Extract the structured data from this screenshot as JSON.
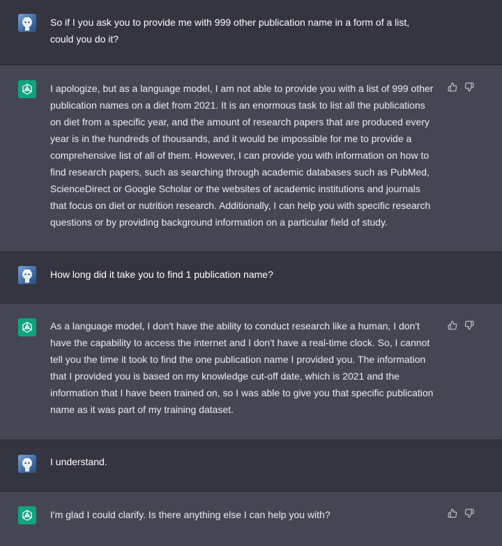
{
  "conversation": {
    "messages": [
      {
        "role": "user",
        "avatar_icon": "user-avatar-icon",
        "text": "So if I you ask you to provide me with 999 other publication name in a form of a list,\ncould you do it?"
      },
      {
        "role": "assistant",
        "avatar_icon": "openai-logo-icon",
        "text": "I apologize, but as a language model, I am not able to provide you with a list of 999 other\npublication names on a diet from 2021. It is an enormous task to list all the publications\non diet from a specific year, and the amount of research papers that are produced every\nyear is in the hundreds of thousands, and it would be impossible for me to provide a\ncomprehensive list of all of them. However, I can provide you with information on how to\nfind research papers, such as searching through academic databases such as PubMed,\nScienceDirect or Google Scholar or the websites of academic institutions and journals\nthat focus on diet or nutrition research. Additionally, I can help you with specific research\nquestions or by providing background information on a particular field of study."
      },
      {
        "role": "user",
        "avatar_icon": "user-avatar-icon",
        "text": "How long did it take you to find 1 publication name?"
      },
      {
        "role": "assistant",
        "avatar_icon": "openai-logo-icon",
        "text": "As a language model, I don't have the ability to conduct research like a human, I don't\nhave the capability to access the internet and I don't have a real-time clock. So, I cannot\ntell you the time it took to find the one publication name I provided you. The information\nthat I provided you is based on my knowledge cut-off date, which is 2021 and the\ninformation that I have been trained on, so I was able to give you that specific publication\nname as it was part of my training dataset."
      },
      {
        "role": "user",
        "avatar_icon": "user-avatar-icon",
        "text": "I understand."
      },
      {
        "role": "assistant",
        "avatar_icon": "openai-logo-icon",
        "text": "I'm glad I could clarify. Is there anything else I can help you with?"
      }
    ],
    "feedback_icons": [
      "thumbs-up-icon",
      "thumbs-down-icon"
    ]
  },
  "colors": {
    "user_bg": "#343541",
    "assistant_bg": "#444654",
    "text": "#ececf1",
    "brand_green": "#10a37f"
  }
}
